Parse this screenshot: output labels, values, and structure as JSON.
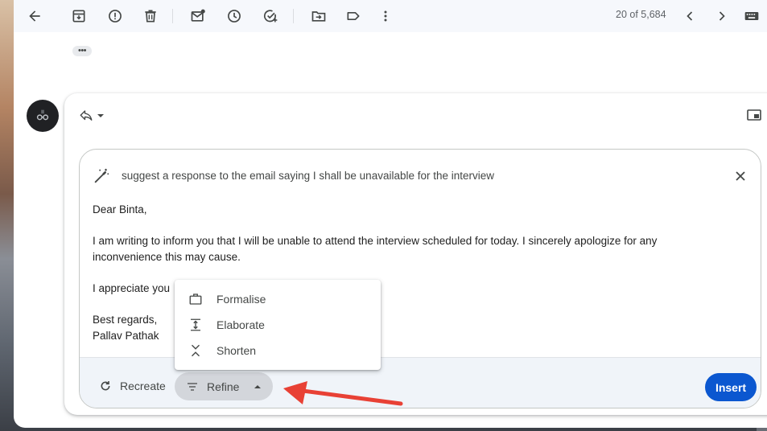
{
  "toolbar": {
    "icons": [
      "back-arrow-icon",
      "archive-icon",
      "report-spam-icon",
      "delete-icon",
      "mark-unread-icon",
      "snooze-icon",
      "add-task-icon",
      "move-to-icon",
      "label-icon",
      "more-vert-icon"
    ],
    "pager_text": "20 of 5,684"
  },
  "thread": {
    "collapsed_indicator": "•••"
  },
  "ai_panel": {
    "prompt": "suggest a response to the email saying I shall be unavailable for the interview",
    "draft": {
      "greeting": "Dear Binta,",
      "paragraph1": "I am writing to inform you that I will be unable to attend the interview scheduled for today. I sincerely apologize for any inconvenience this may cause.",
      "paragraph2": "I appreciate you",
      "closing": "Best regards,",
      "signature": "Pallav Pathak"
    },
    "actions": {
      "recreate_label": "Recreate",
      "refine_label": "Refine",
      "insert_label": "Insert"
    }
  },
  "refine_menu": {
    "items": [
      {
        "label": "Formalise",
        "icon": "briefcase-icon"
      },
      {
        "label": "Elaborate",
        "icon": "expand-vertical-icon"
      },
      {
        "label": "Shorten",
        "icon": "compress-vertical-icon"
      }
    ]
  },
  "colors": {
    "accent": "#0b57d0",
    "annotation_arrow": "#e84135",
    "toolbar_bg": "#f6f8fc",
    "action_bar_bg": "#f0f4f9"
  }
}
